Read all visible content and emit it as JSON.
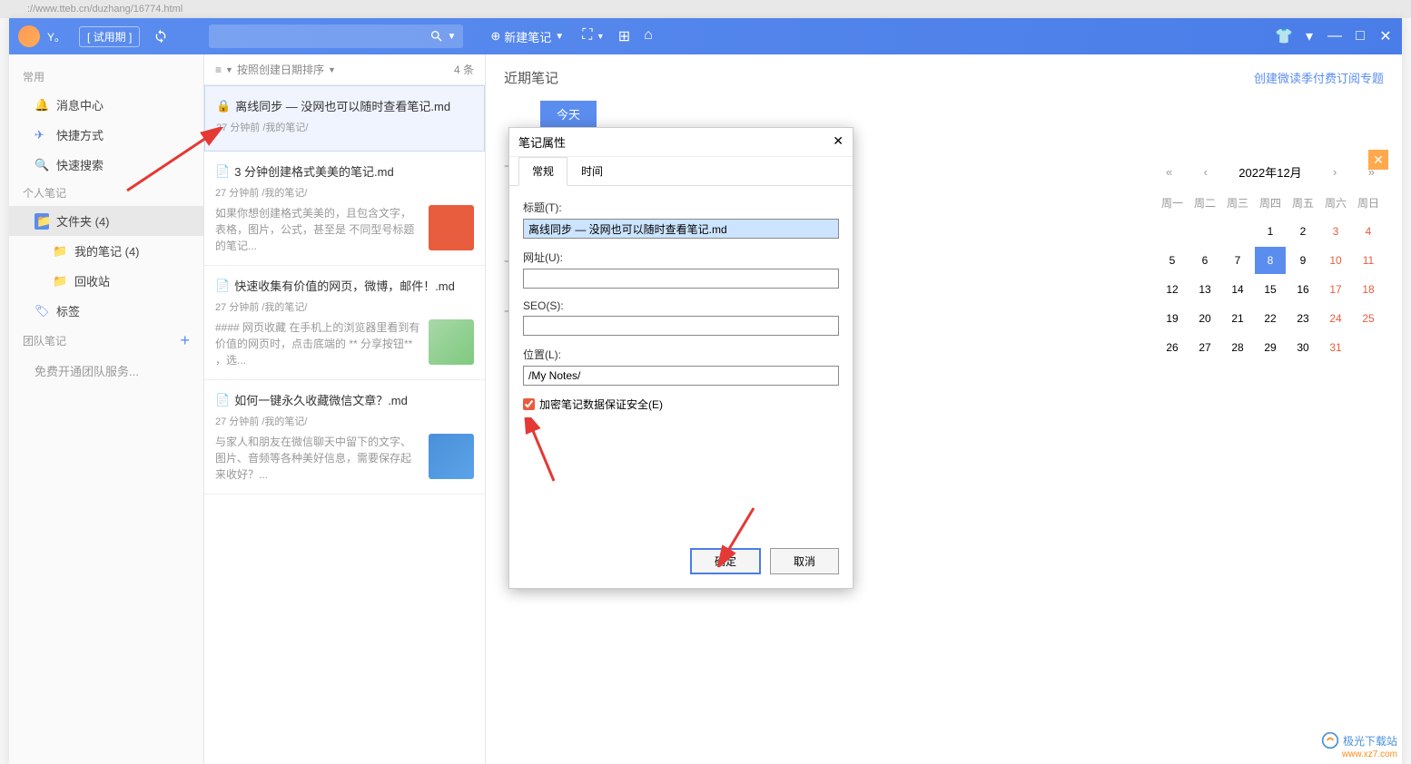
{
  "browser": {
    "url": "://www.tteb.cn/duzhang/16774.html"
  },
  "titlebar": {
    "username": "Y。",
    "trial": "[ 试用期 ]",
    "new_note": "新建笔记"
  },
  "sidebar": {
    "common_header": "常用",
    "common": [
      {
        "icon": "bell",
        "label": "消息中心"
      },
      {
        "icon": "rocket",
        "label": "快捷方式"
      },
      {
        "icon": "search",
        "label": "快速搜索"
      }
    ],
    "personal_header": "个人笔记",
    "folders": {
      "root": "文件夹 (4)",
      "my_notes": "我的笔记 (4)",
      "recycle": "回收站"
    },
    "tags": "标签",
    "team_header": "团队笔记",
    "team_free": "免费开通团队服务..."
  },
  "notelist": {
    "sort_label": "按照创建日期排序",
    "count": "4 条",
    "notes": [
      {
        "title": "离线同步 — 没网也可以随时查看笔记.md",
        "time": "27 分钟前",
        "folder": "/我的笔记/",
        "preview": ""
      },
      {
        "title": "3 分钟创建格式美美的笔记.md",
        "time": "27 分钟前",
        "folder": "/我的笔记/",
        "preview": "如果你想创建格式美美的，且包含文字，表格，图片，公式，甚至是 不同型号标题的笔记..."
      },
      {
        "title": "快速收集有价值的网页，微博，邮件！.md",
        "time": "27 分钟前",
        "folder": "/我的笔记/",
        "preview": "#### 网页收藏 在手机上的浏览器里看到有价值的网页时，点击底端的 ** 分享按钮** ，选..."
      },
      {
        "title": "如何一键永久收藏微信文章？.md",
        "time": "27 分钟前",
        "folder": "/我的笔记/",
        "preview": "与家人和朋友在微信聊天中留下的文字、图片、音频等各种美好信息，需要保存起来收好？..."
      }
    ]
  },
  "content": {
    "title": "近期笔记",
    "subscribe": "创建微读季付费订阅专题",
    "today": "今天"
  },
  "calendar": {
    "title": "2022年12月",
    "days_header": [
      "周一",
      "周二",
      "周三",
      "周四",
      "周五",
      "周六",
      "周日"
    ],
    "weeks": [
      [
        "",
        "",
        "",
        "1",
        "2",
        "3",
        "4"
      ],
      [
        "5",
        "6",
        "7",
        "8",
        "9",
        "10",
        "11"
      ],
      [
        "12",
        "13",
        "14",
        "15",
        "16",
        "17",
        "18"
      ],
      [
        "19",
        "20",
        "21",
        "22",
        "23",
        "24",
        "25"
      ],
      [
        "26",
        "27",
        "28",
        "29",
        "30",
        "31",
        ""
      ]
    ],
    "today": "8"
  },
  "dialog": {
    "title": "笔记属性",
    "tab_general": "常规",
    "tab_time": "时间",
    "label_title": "标题(T):",
    "value_title": "离线同步 — 没网也可以随时查看笔记.md",
    "label_url": "网址(U):",
    "value_url": "",
    "label_seo": "SEO(S):",
    "value_seo": "",
    "label_location": "位置(L):",
    "value_location": "/My Notes/",
    "checkbox_encrypt": "加密笔记数据保证安全(E)",
    "btn_ok": "确定",
    "btn_cancel": "取消"
  },
  "watermark": {
    "main": "极光下载站",
    "sub": "www.xz7.com"
  }
}
